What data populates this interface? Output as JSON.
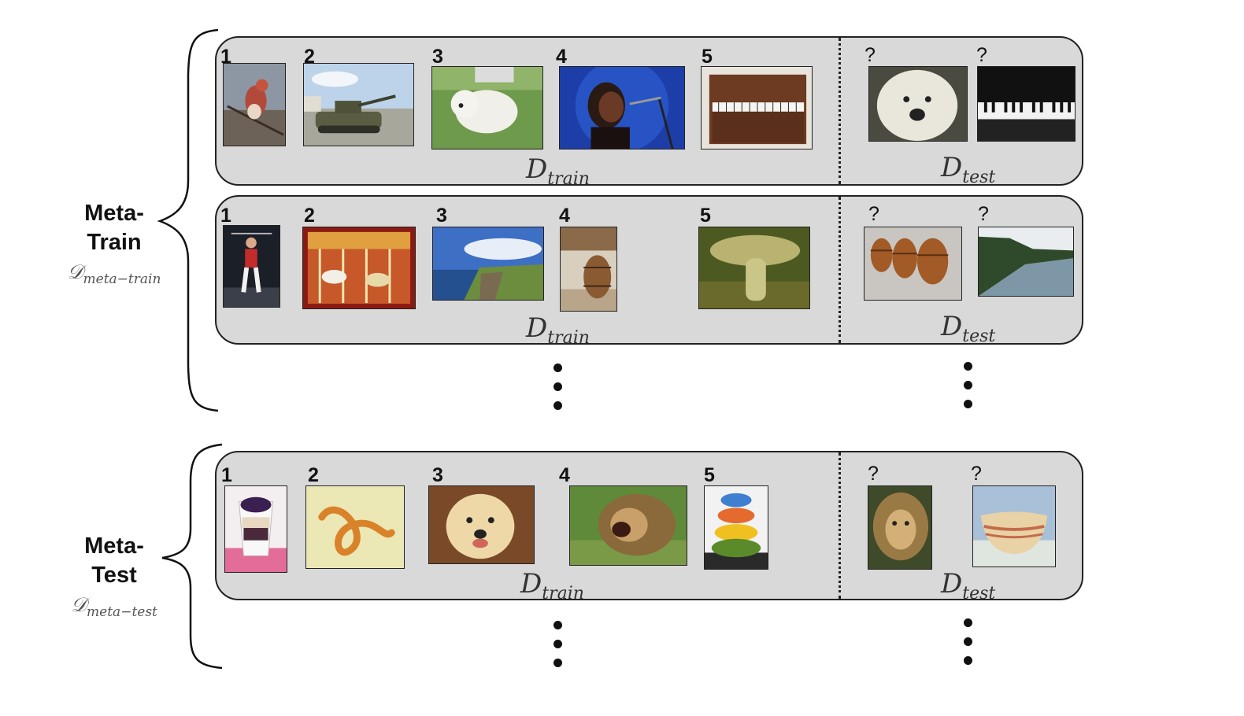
{
  "groups": [
    {
      "title_line1": "Meta-",
      "title_line2": "Train",
      "symbol_main": "𝒟",
      "symbol_sub": "meta−train"
    },
    {
      "title_line1": "Meta-",
      "title_line2": "Test",
      "symbol_main": "𝒟",
      "symbol_sub": "meta−test"
    }
  ],
  "set_labels": {
    "train_main": "D",
    "train_sub": "train",
    "test_main": "D",
    "test_sub": "test"
  },
  "shot_numbers": [
    "1",
    "2",
    "3",
    "4",
    "5"
  ],
  "query_mark": "?",
  "episodes": [
    {
      "train": [
        "bird",
        "tank",
        "dog",
        "singer",
        "piano"
      ],
      "test": [
        "dog",
        "piano"
      ]
    },
    {
      "train": [
        "gymnast",
        "carousel",
        "cliffs",
        "barrel",
        "mushroom"
      ],
      "test": [
        "barrels",
        "cliffs"
      ]
    },
    {
      "train": [
        "parfait",
        "nematode",
        "golden retriever",
        "lion",
        "bowls"
      ],
      "test": [
        "lion",
        "bowl"
      ]
    }
  ],
  "colors": {
    "panel": "#d9d9d9",
    "border": "#222222"
  }
}
